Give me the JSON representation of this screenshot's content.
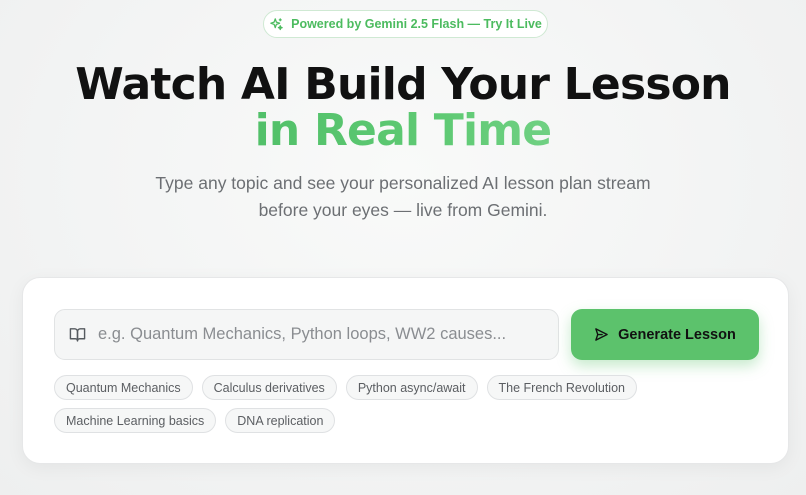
{
  "badge": {
    "icon": "sparkles-icon",
    "text": "Powered by Gemini 2.5 Flash — Try It Live",
    "color": "#4cbb5f"
  },
  "hero": {
    "title_line1": "Watch AI Build Your Lesson",
    "title_line2": "in Real Time",
    "subtitle_line1": "Type any topic and see your personalized AI lesson plan stream",
    "subtitle_line2": "before your eyes — live from Gemini."
  },
  "form": {
    "input_icon": "book-icon",
    "input_placeholder": "e.g. Quantum Mechanics, Python loops, WW2 causes...",
    "input_value": "",
    "button_icon": "send-icon",
    "button_label": "Generate Lesson",
    "accent": "#5cc26c"
  },
  "suggestions": {
    "row1": [
      "Quantum Mechanics",
      "Calculus derivatives",
      "Python async/await",
      "The French Revolution"
    ],
    "row2": [
      "Machine Learning basics",
      "DNA replication"
    ]
  }
}
